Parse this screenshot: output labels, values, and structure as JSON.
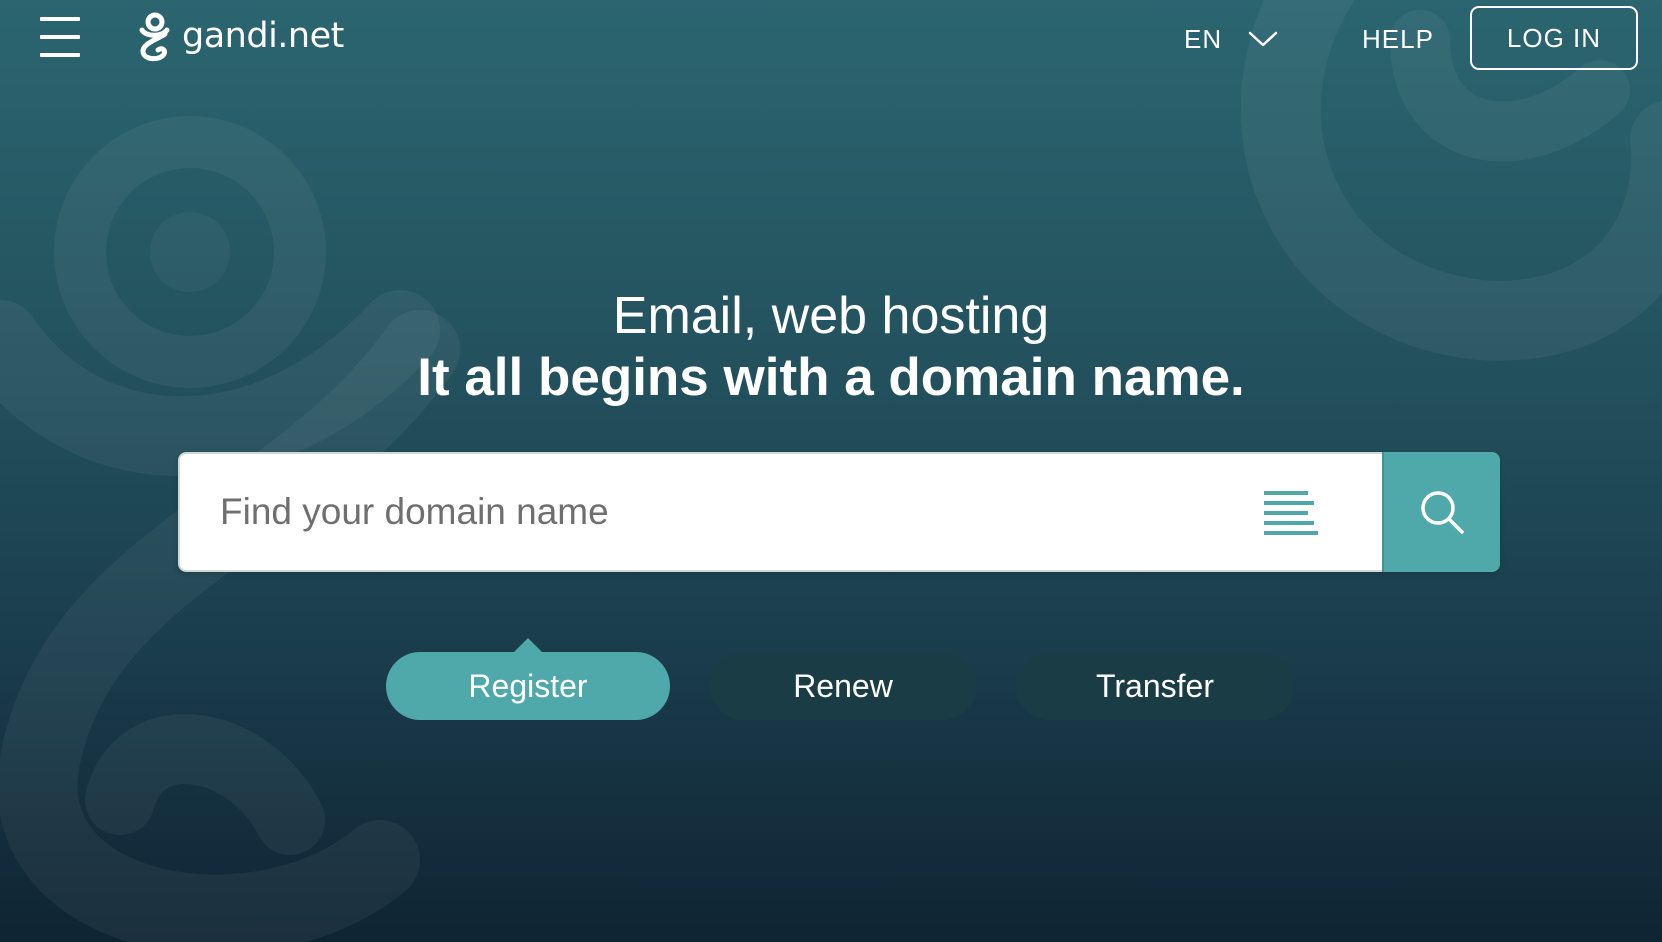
{
  "header": {
    "logo_text": "gandi.net",
    "language": "EN",
    "help_label": "HELP",
    "login_label": "LOG IN"
  },
  "hero": {
    "title": "Email, web hosting",
    "subtitle": "It all begins with a domain name."
  },
  "search": {
    "placeholder": "Find your domain name",
    "value": ""
  },
  "modes": [
    {
      "label": "Register",
      "active": true
    },
    {
      "label": "Renew",
      "active": false
    },
    {
      "label": "Transfer",
      "active": false
    }
  ],
  "colors": {
    "accent": "#4fa9aa",
    "inactive_tab": "#1a3d45",
    "background_top": "#2b6570",
    "background_bottom": "#0f2433"
  },
  "icons": {
    "menu": "hamburger-menu-icon",
    "logo": "gandi-logo-icon",
    "language": "chevron-down-icon",
    "list": "list-lines-icon",
    "search": "magnifier-icon"
  }
}
